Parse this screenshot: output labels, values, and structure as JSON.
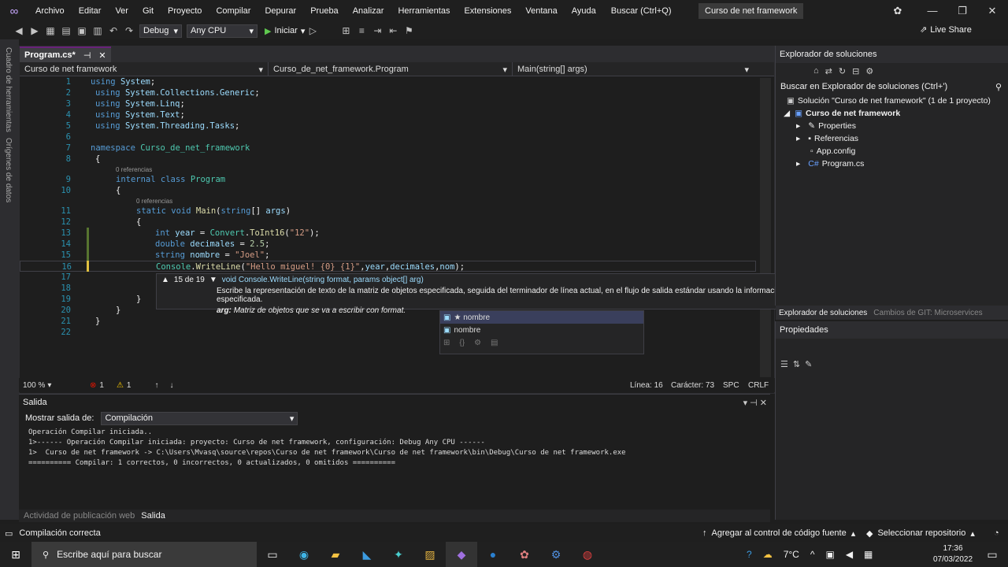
{
  "menu": {
    "items": [
      "Archivo",
      "Editar",
      "Ver",
      "Git",
      "Proyecto",
      "Compilar",
      "Depurar",
      "Prueba",
      "Analizar",
      "Herramientas",
      "Extensiones",
      "Ventana",
      "Ayuda"
    ],
    "search": "Buscar (Ctrl+Q)",
    "solution_title": "Curso de net framework"
  },
  "toolbar": {
    "config": "Debug",
    "platform": "Any CPU",
    "start": "Iniciar",
    "live_share": "Live Share"
  },
  "side_tabs": [
    "Cuadro de herramientas",
    "Orígenes de datos"
  ],
  "doc_tab": {
    "name": "Program.cs*"
  },
  "nav": {
    "project": "Curso de net framework",
    "class": "Curso_de_net_framework.Program",
    "method": "Main(string[] args)"
  },
  "code": {
    "lines": [
      "1",
      "2",
      "3",
      "4",
      "5",
      "6",
      "7",
      "8",
      "9",
      "10",
      "11",
      "12",
      "13",
      "14",
      "15",
      "16",
      "17",
      "18",
      "19",
      "20",
      "21",
      "22"
    ],
    "refs0": "0 referencias",
    "refs1": "0 referencias"
  },
  "tooltip": {
    "counter": "15 de 19",
    "signature": "void Console.WriteLine(string format, params object[] arg)",
    "desc": "Escribe la representación de texto de la matriz de objetos especificada, seguida del terminador de línea actual, en el flujo de salida estándar usando la información de formato especificada.",
    "arg_label": "arg:",
    "arg_desc": "Matriz de objetos que se va a escribir con format."
  },
  "intellisense": {
    "items": [
      "★ nombre",
      "nombre"
    ]
  },
  "editor_status": {
    "zoom": "100 %",
    "errors": "1",
    "warnings": "1",
    "line": "Línea: 16",
    "char": "Carácter: 73",
    "spc": "SPC",
    "crlf": "CRLF"
  },
  "output": {
    "title": "Salida",
    "show_label": "Mostrar salida de:",
    "source": "Compilación",
    "lines": [
      "Operación Compilar iniciada..",
      "1>------ Operación Compilar iniciada: proyecto: Curso de net framework, configuración: Debug Any CPU ------",
      "1>  Curso de net framework -> C:\\Users\\Mvasq\\source\\repos\\Curso de net framework\\Curso de net framework\\bin\\Debug\\Curso de net framework.exe",
      "========== Compilar: 1 correctos, 0 incorrectos, 0 actualizados, 0 omitidos =========="
    ],
    "tab1": "Actividad de publicación web",
    "tab2": "Salida"
  },
  "solution": {
    "title": "Explorador de soluciones",
    "search": "Buscar en Explorador de soluciones (Ctrl+')",
    "root": "Solución \"Curso de net framework\" (1 de 1 proyecto)",
    "project": "Curso de net framework",
    "items": [
      "Properties",
      "Referencias",
      "App.config",
      "Program.cs"
    ],
    "tab1": "Explorador de soluciones",
    "tab2": "Cambios de GIT: Microservices"
  },
  "props": {
    "title": "Propiedades"
  },
  "status": {
    "left": "Compilación correcta",
    "scm": "Agregar al control de código fuente",
    "repo": "Seleccionar repositorio"
  },
  "taskbar": {
    "search": "Escribe aquí para buscar",
    "temp": "7°C",
    "time": "17:36",
    "date": "07/03/2022"
  }
}
